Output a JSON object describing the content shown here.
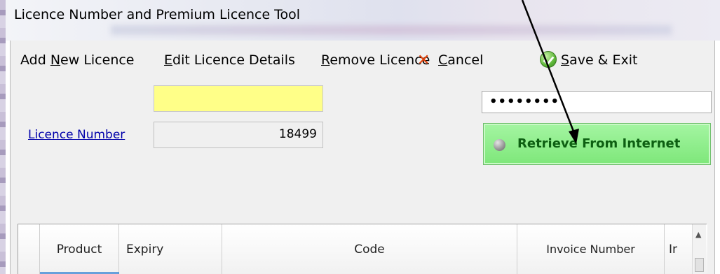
{
  "window": {
    "title": "Licence Number and Premium Licence Tool"
  },
  "toolbar": {
    "add_new_prefix": "Add ",
    "add_new_mnemonic": "N",
    "add_new_suffix": "ew Licence",
    "edit_mnemonic": "E",
    "edit_suffix": "dit Licence Details",
    "remove_mnemonic": "R",
    "remove_suffix": "emove Licence",
    "cancel_mnemonic": "C",
    "cancel_suffix": "ancel",
    "save_mnemonic": "S",
    "save_suffix": "ave & Exit",
    "cancel_icon": "close-x-icon",
    "save_icon": "check-circle-icon"
  },
  "form": {
    "yellow_value": "",
    "password_mask": "••••••••",
    "licence_label": "Licence Number",
    "licence_value": "18499",
    "retrieve_label": "Retrieve From Internet"
  },
  "grid": {
    "columns": [
      "Product",
      "Expiry",
      "Code",
      "Invoice Number",
      "Ir"
    ]
  },
  "colors": {
    "cancel": "#e0420b",
    "save": "#5fb83a",
    "retrieve_bg": "#7ee77a",
    "retrieve_text": "#0d5f12",
    "highlight_field": "#ffff88",
    "link": "#0000aa"
  }
}
